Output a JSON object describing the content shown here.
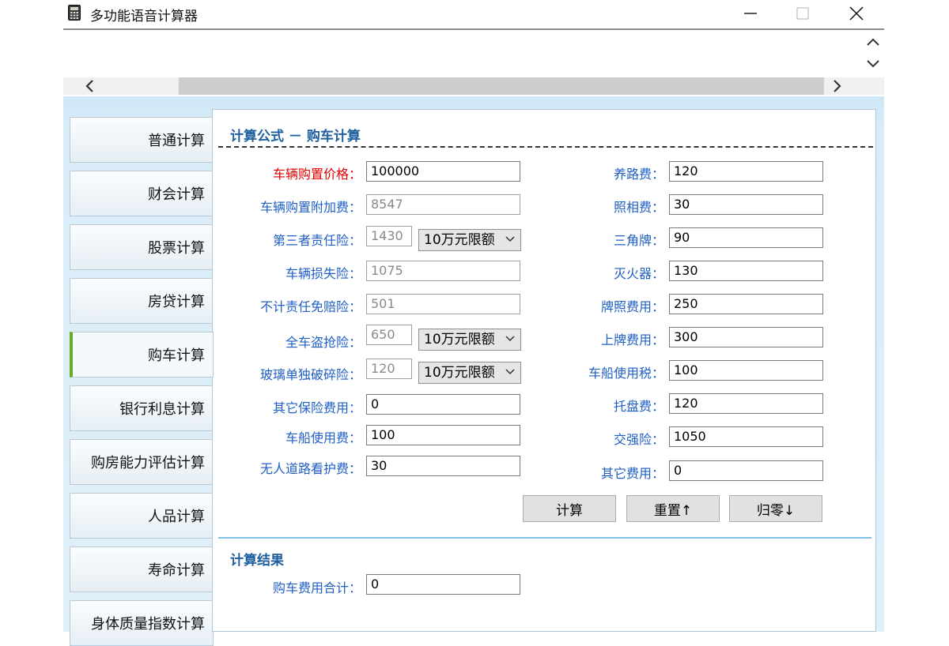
{
  "window": {
    "title": "多功能语音计算器"
  },
  "sidebar": {
    "items": [
      {
        "label": "普通计算"
      },
      {
        "label": "财会计算"
      },
      {
        "label": "股票计算"
      },
      {
        "label": "房贷计算"
      },
      {
        "label": "购车计算",
        "active": true
      },
      {
        "label": "银行利息计算"
      },
      {
        "label": "购房能力评估计算"
      },
      {
        "label": "人品计算"
      },
      {
        "label": "寿命计算"
      },
      {
        "label": "身体质量指数计算"
      }
    ]
  },
  "form": {
    "title": "计算公式 － 购车计算",
    "left": [
      {
        "label": "车辆购置价格：",
        "value": "100000"
      },
      {
        "label": "车辆购置附加费：",
        "value": "8547"
      },
      {
        "label": "第三者责任险：",
        "value": "1430",
        "select": "10万元限额"
      },
      {
        "label": "车辆损失险：",
        "value": "1075"
      },
      {
        "label": "不计责任免赔险：",
        "value": "501"
      },
      {
        "label": "全车盗抢险：",
        "value": "650",
        "select": "10万元限额"
      },
      {
        "label": "玻璃单独破碎险：",
        "value": "120",
        "select": "10万元限额"
      },
      {
        "label": "其它保险费用：",
        "value": "0"
      },
      {
        "label": "车船使用费：",
        "value": "100"
      },
      {
        "label": "无人道路看护费：",
        "value": "30"
      }
    ],
    "right": [
      {
        "label": "养路费：",
        "value": "120"
      },
      {
        "label": "照相费：",
        "value": "30"
      },
      {
        "label": "三角牌：",
        "value": "90"
      },
      {
        "label": "灭火器：",
        "value": "130"
      },
      {
        "label": "牌照费用：",
        "value": "250"
      },
      {
        "label": "上牌费用：",
        "value": "300"
      },
      {
        "label": "车船使用税：",
        "value": "100"
      },
      {
        "label": "托盘费：",
        "value": "120"
      },
      {
        "label": "交强险：",
        "value": "1050"
      },
      {
        "label": "其它费用：",
        "value": "0"
      }
    ],
    "buttons": {
      "calculate": "计算",
      "reset": "重置↑",
      "zero": "归零↓"
    }
  },
  "result": {
    "title": "计算结果",
    "label": "购车费用合计：",
    "value": "0"
  },
  "colors": {
    "label_blue": "#1f5fc4",
    "label_red": "#e00000",
    "section_title": "#1f5f9e",
    "active_accent": "#6aaa28"
  }
}
